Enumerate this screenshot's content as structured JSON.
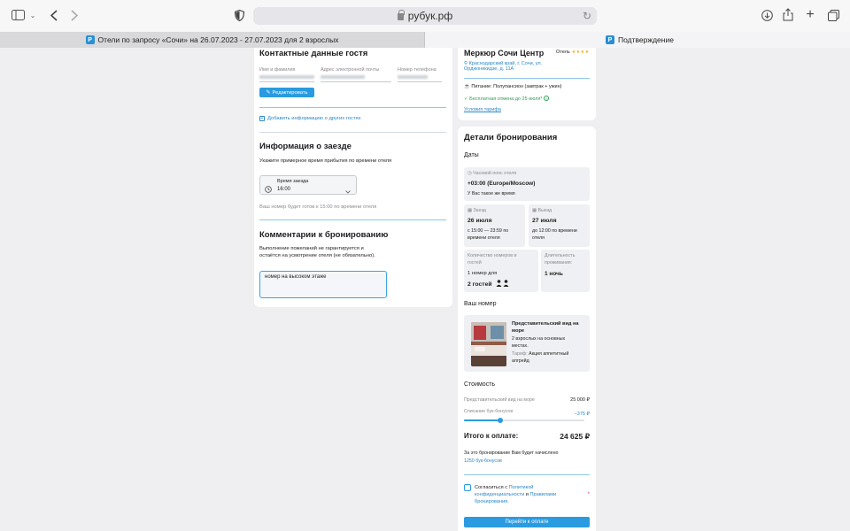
{
  "browser": {
    "url": "рубук.рф",
    "tabs": [
      {
        "title": "Отели по запросу «Сочи» на 26.07.2023 - 27.07.2023 для 2 взрослых"
      },
      {
        "title": "Подтверждение"
      }
    ],
    "favicon_letter": "Р"
  },
  "contacts": {
    "title": "Контактные данные гостя",
    "name_label": "Имя и фамилия",
    "email_label": "Адрес электронной почты",
    "phone_label": "Номер телефона",
    "edit_button": "Редактировать",
    "add_guests_link": "Добавить информацию о других гостях"
  },
  "checkin": {
    "title": "Информация о заезде",
    "subtitle": "Укажите примерное время прибытия по времени отеля",
    "select_label": "Время заезда",
    "select_value": "16:00",
    "note": "Ваш номер будет готов к 15:00 по времени отеля"
  },
  "comments": {
    "title": "Комментарии к бронированию",
    "note_line1": "Выполнение пожеланий не гарантируется и",
    "note_line2": "остаётся на усмотрение отеля (не обязательно).",
    "value": "номер на высоком этаже"
  },
  "hotel": {
    "name": "Меркюр Сочи Центр",
    "type": "Отель",
    "stars": "★★★★",
    "address_line1": "Краснодарский край, г. Сочи, ул.",
    "address_line2": "Орджоникидзе, д. 11А",
    "meal": "Питание: Полупансион (завтрак + ужин)",
    "cancellation": "Бесплатная отмена до 25 июля*",
    "tariff_link": "Условия тарифа"
  },
  "booking": {
    "title": "Детали бронирования",
    "dates_title": "Даты",
    "tz_label": "Часовой пояс отеля",
    "tz_value": "+03:00 (Europe/Moscow)",
    "tz_note": "У Вас такое же время",
    "checkin_label": "Заезд",
    "checkin_date": "26 июля",
    "checkin_time1": "с 15:00 — 23:59 по",
    "checkin_time2": "времени отеля",
    "checkout_label": "Выезд",
    "checkout_date": "27 июля",
    "checkout_time1": "до 12:00 по времени",
    "checkout_time2": "отеля",
    "rooms_label1": "Количество номеров и",
    "rooms_label2": "гостей",
    "rooms_value": "1 номер для",
    "guests_value": "2 гостей",
    "duration_label1": "Длительность",
    "duration_label2": "проживания:",
    "duration_value": "1 ночь"
  },
  "room": {
    "title": "Ваш номер",
    "name_line1": "Представительский вид на",
    "name_line2": "море",
    "desc_line1": "2 взрослых на основных",
    "desc_line2": "местах.",
    "tariff_label": "Тариф:",
    "tariff_value1": "Акция аппетитный",
    "tariff_value2": "апгрейд"
  },
  "cost": {
    "title": "Стоимость",
    "room_label": "Представительский вид на море",
    "room_price": "25 000 ₽",
    "bonus_label": "Списание бук-бонусов",
    "bonus_value": "−375 ₽",
    "bonus_fraction": 0.3,
    "total_label": "Итого к оплате:",
    "total_value": "24 625 ₽",
    "accrual_note": "За это бронирование Вам будет начислено",
    "accrual_value": "1250 бук-бонусов"
  },
  "consent": {
    "prefix": "Согласиться с",
    "link1": "Политикой",
    "link2": "конфиденциальности",
    "and": "и",
    "link3": "Правилами",
    "link4": "бронирования.",
    "required_mark": "*"
  },
  "pay_button": "Перейти к оплате",
  "colors": {
    "accent": "#2a9be0",
    "link": "#2a87c9",
    "star": "#f3a71b"
  }
}
